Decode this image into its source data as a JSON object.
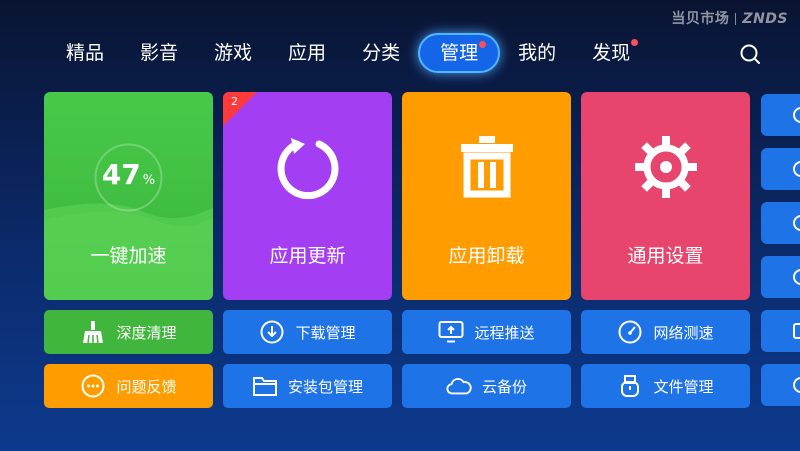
{
  "watermark": {
    "left": "当贝市场",
    "right": "ZNDS"
  },
  "nav": {
    "items": [
      {
        "label": "精品"
      },
      {
        "label": "影音"
      },
      {
        "label": "游戏"
      },
      {
        "label": "应用"
      },
      {
        "label": "分类"
      },
      {
        "label": "管理"
      },
      {
        "label": "我的"
      },
      {
        "label": "发现"
      }
    ],
    "active": "管理"
  },
  "cards": {
    "speed": {
      "title": "一键加速",
      "percent": "47",
      "unit": "%",
      "memory_used_fraction": 0.47
    },
    "update": {
      "title": "应用更新",
      "badge": "2"
    },
    "uninstall": {
      "title": "应用卸载"
    },
    "settings": {
      "title": "通用设置"
    }
  },
  "buttons": {
    "clean": "深度清理",
    "feedback": "问题反馈",
    "download": "下载管理",
    "installer": "安装包管理",
    "remote_push": "远程推送",
    "cloud_backup": "云备份",
    "speed_test": "网络测速",
    "file_manager": "文件管理"
  },
  "colors": {
    "speed_card": "#3ab53a",
    "update_card": "#a33ef3",
    "uninstall_card": "#ff9d00",
    "settings_card": "#e8456e",
    "button_blue": "#1e73e6",
    "active_tab": "#1565e8",
    "badge_red": "#ff3a3a"
  }
}
